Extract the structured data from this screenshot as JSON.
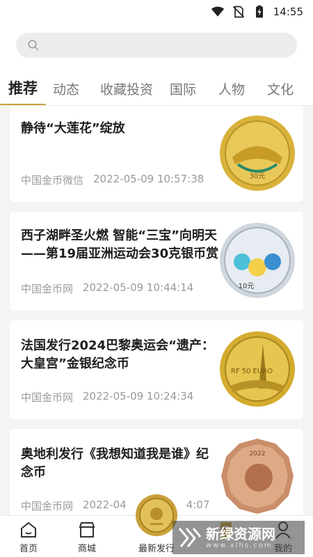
{
  "status_bar": {
    "time": "14:55",
    "icons": [
      "wifi-icon",
      "no-sim-icon",
      "battery-charging-icon"
    ]
  },
  "search": {
    "placeholder": "",
    "icon": "search-icon"
  },
  "tabs": [
    {
      "label": "推荐",
      "active": true
    },
    {
      "label": "动态",
      "active": false
    },
    {
      "label": "收藏投资",
      "active": false
    },
    {
      "label": "国际",
      "active": false
    },
    {
      "label": "人物",
      "active": false
    },
    {
      "label": "文化",
      "active": false
    }
  ],
  "articles": [
    {
      "title": "静待“大莲花”绽放",
      "source": "中国金币微信",
      "time": "2022-05-09 10:57:38",
      "coin_label": "30元",
      "coin_color": "#d9b23a"
    },
    {
      "title": "西子湖畔圣火燃 智能“三宝”向明天——第19届亚洲运动会30克银币赏",
      "source": "中国金币网",
      "time": "2022-05-09 10:44:14",
      "coin_label": "10元",
      "coin_color": "#cfd6dd"
    },
    {
      "title": "法国发行2024巴黎奥运会“遗产：大皇宫”金银纪念币",
      "source": "中国金币网",
      "time": "2022-05-09 10:24:34",
      "coin_label": "RF 50 EURO",
      "coin_color": "#d4ac2e"
    },
    {
      "title": "奥地利发行《我想知道我是谁》纪念币",
      "source": "中国金币网",
      "time": "2022-04",
      "time_tail": "4:07",
      "coin_label": "2022",
      "coin_color": "#c98e6a"
    }
  ],
  "bottom_nav": [
    {
      "label": "首页",
      "icon": "home-icon"
    },
    {
      "label": "商城",
      "icon": "shop-icon"
    },
    {
      "label": "最新发行",
      "icon": "gold-coin-icon"
    },
    {
      "label": "",
      "icon": "document-icon"
    },
    {
      "label": "我的",
      "icon": "user-icon"
    }
  ],
  "watermark": {
    "text": "新绿资源网",
    "sub": "www.xlhs.com"
  },
  "colors": {
    "accent": "#c8a23c",
    "text_primary": "#1e1e1e",
    "text_secondary": "#9a9a9a",
    "background": "#f4f4f4"
  }
}
